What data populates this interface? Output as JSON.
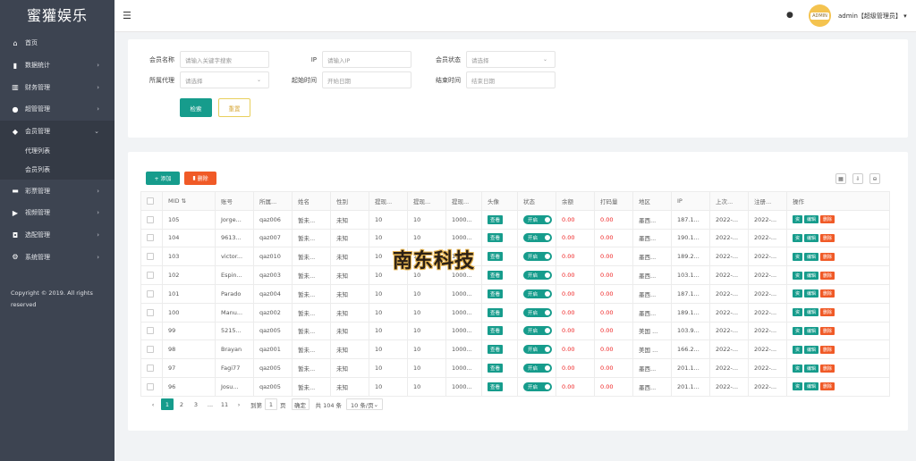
{
  "app": {
    "title": "蜜獾娱乐"
  },
  "sidebar": {
    "items": [
      {
        "label": "首页",
        "icon": "home-icon",
        "arrow": ""
      },
      {
        "label": "数据统计",
        "icon": "chart-icon",
        "arrow": "›"
      },
      {
        "label": "财务管理",
        "icon": "bank-icon",
        "arrow": "›"
      },
      {
        "label": "超管管理",
        "icon": "user-icon",
        "arrow": "›"
      },
      {
        "label": "会员管理",
        "icon": "users-icon",
        "arrow": "⌄"
      },
      {
        "label": "彩票管理",
        "icon": "ticket-icon",
        "arrow": "›"
      },
      {
        "label": "视频管理",
        "icon": "video-icon",
        "arrow": "›"
      },
      {
        "label": "选配管理",
        "icon": "tag-icon",
        "arrow": "›"
      },
      {
        "label": "系统管理",
        "icon": "gear-icon",
        "arrow": "›"
      }
    ],
    "sub_items": [
      "代理列表",
      "会员列表"
    ],
    "copyright": "Copyright © 2019. All rights reserved"
  },
  "header": {
    "user": "admin【超级管理员】",
    "avatar_text": "ADMIN"
  },
  "filters": {
    "member_name_label": "会员名称",
    "member_name_placeholder": "请输入关键字搜索",
    "ip_label": "IP",
    "ip_placeholder": "请输入IP",
    "status_label": "会员状态",
    "status_placeholder": "请选择",
    "agent_label": "所属代理",
    "agent_placeholder": "请选择",
    "start_label": "起始时间",
    "start_placeholder": "开始日期",
    "end_label": "结束时间",
    "end_placeholder": "结束日期",
    "search_button": "检索",
    "reset_button": "重置"
  },
  "toolbar": {
    "add_label": "+ 添加",
    "delete_label": "删除"
  },
  "table": {
    "headers": [
      "MID",
      "账号",
      "所属...",
      "姓名",
      "性别",
      "提现...",
      "提现...",
      "提现...",
      "头像",
      "状态",
      "余额",
      "打码量",
      "地区",
      "IP",
      "上次...",
      "注册...",
      "操作"
    ],
    "rows": [
      [
        "105",
        "Jorge...",
        "qaz006",
        "暂未...",
        "未知",
        "10",
        "10",
        "1000...",
        "0.00",
        "0.00",
        "墨西...",
        "187.1...",
        "2022-...",
        "2022-..."
      ],
      [
        "104",
        "9613...",
        "qaz007",
        "暂未...",
        "未知",
        "10",
        "10",
        "1000...",
        "0.00",
        "0.00",
        "墨西...",
        "190.1...",
        "2022-...",
        "2022-..."
      ],
      [
        "103",
        "victor...",
        "qaz010",
        "暂未...",
        "未知",
        "10",
        "10",
        "1000...",
        "0.00",
        "0.00",
        "墨西...",
        "189.2...",
        "2022-...",
        "2022-..."
      ],
      [
        "102",
        "Espin...",
        "qaz003",
        "暂未...",
        "未知",
        "10",
        "10",
        "1000...",
        "0.00",
        "0.00",
        "墨西...",
        "103.1...",
        "2022-...",
        "2022-..."
      ],
      [
        "101",
        "Parado",
        "qaz004",
        "暂未...",
        "未知",
        "10",
        "10",
        "1000...",
        "0.00",
        "0.00",
        "墨西...",
        "187.1...",
        "2022-...",
        "2022-..."
      ],
      [
        "100",
        "Manu...",
        "qaz002",
        "暂未...",
        "未知",
        "10",
        "10",
        "1000...",
        "0.00",
        "0.00",
        "墨西...",
        "189.1...",
        "2022-...",
        "2022-..."
      ],
      [
        "99",
        "5215...",
        "qaz005",
        "暂未...",
        "未知",
        "10",
        "10",
        "1000...",
        "0.00",
        "0.00",
        "美国 ...",
        "103.9...",
        "2022-...",
        "2022-..."
      ],
      [
        "98",
        "Brayan",
        "qaz001",
        "暂未...",
        "未知",
        "10",
        "10",
        "1000...",
        "0.00",
        "0.00",
        "美国 ...",
        "166.2...",
        "2022-...",
        "2022-..."
      ],
      [
        "97",
        "Fagi77",
        "qaz005",
        "暂未...",
        "未知",
        "10",
        "10",
        "1000...",
        "0.00",
        "0.00",
        "墨西...",
        "201.1...",
        "2022-...",
        "2022-..."
      ],
      [
        "96",
        "Josu...",
        "qaz005",
        "暂未...",
        "未知",
        "10",
        "10",
        "1000...",
        "0.00",
        "0.00",
        "墨西...",
        "201.1...",
        "2022-...",
        "2022-..."
      ]
    ],
    "view_label": "查看",
    "switch_label": "开启",
    "op_labels": [
      "资",
      "编辑",
      "删除"
    ]
  },
  "pager": {
    "prev": "‹",
    "pages": [
      "1",
      "2",
      "3",
      "...",
      "11"
    ],
    "next": "›",
    "goto_label": "到第",
    "goto_value": "1",
    "page_suffix": "页",
    "confirm": "确定",
    "total": "共 104 条",
    "size": "10 条/页"
  },
  "watermark": {
    "text": "南东科技"
  },
  "colors": {
    "accent": "#169c8c",
    "danger": "#f05a27",
    "sidebar": "#3d4451"
  }
}
